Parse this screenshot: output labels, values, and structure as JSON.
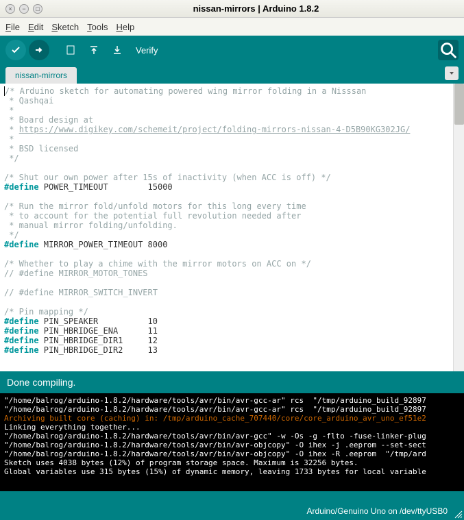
{
  "window": {
    "title": "nissan-mirrors | Arduino 1.8.2"
  },
  "menu": {
    "file": "File",
    "edit": "Edit",
    "sketch": "Sketch",
    "tools": "Tools",
    "help": "Help"
  },
  "toolbar": {
    "verify_label": "Verify"
  },
  "tab": {
    "name": "nissan-mirrors"
  },
  "code": {
    "c1": "/* Arduino sketch for automating powered wing mirror folding in a Nisssan",
    "c2": " * Qashqai",
    "c3": " *",
    "c4": " * Board design at",
    "c5a": " * ",
    "c5link": "https://www.digikey.com/schemeit/project/folding-mirrors-nissan-4-D5B90KG302JG/",
    "c6": " *",
    "c7": " * BSD licensed",
    "c8": " */",
    "c9": "/* Shut our own power after 15s of inactivity (when ACC is off) */",
    "d1": "#define",
    "d1n": " POWER_TIMEOUT        15000",
    "c10": "/* Run the mirror fold/unfold motors for this long every time",
    "c11": " * to account for the potential full revolution needed after",
    "c12": " * manual mirror folding/unfolding.",
    "c13": " */",
    "d2n": " MIRROR_POWER_TIMEOUT 8000",
    "c14": "/* Whether to play a chime with the mirror motors on ACC on */",
    "c15": "// #define MIRROR_MOTOR_TONES",
    "c16": "// #define MIRROR_SWITCH_INVERT",
    "c17": "/* Pin mapping */",
    "d3n": " PIN_SPEAKER          10",
    "d4n": " PIN_HBRIDGE_ENA      11",
    "d5n": " PIN_HBRIDGE_DIR1     12",
    "d6n": " PIN_HBRIDGE_DIR2     13"
  },
  "status": {
    "text": "Done compiling."
  },
  "console": {
    "l1": "\"/home/balrog/arduino-1.8.2/hardware/tools/avr/bin/avr-gcc-ar\" rcs  \"/tmp/arduino_build_92897",
    "l2": "\"/home/balrog/arduino-1.8.2/hardware/tools/avr/bin/avr-gcc-ar\" rcs  \"/tmp/arduino_build_92897",
    "l3": "Archiving built core (caching) in: /tmp/arduino_cache_707440/core/core_arduino_avr_uno_ef51e2",
    "l4": "Linking everything together...",
    "l5": "\"/home/balrog/arduino-1.8.2/hardware/tools/avr/bin/avr-gcc\" -w -Os -g -flto -fuse-linker-plug",
    "l6": "\"/home/balrog/arduino-1.8.2/hardware/tools/avr/bin/avr-objcopy\" -O ihex -j .eeprom --set-sect",
    "l7": "\"/home/balrog/arduino-1.8.2/hardware/tools/avr/bin/avr-objcopy\" -O ihex -R .eeprom  \"/tmp/ard",
    "l8": "Sketch uses 4038 bytes (12%) of program storage space. Maximum is 32256 bytes.",
    "l9": "Global variables use 315 bytes (15%) of dynamic memory, leaving 1733 bytes for local variable"
  },
  "footer": {
    "board": "Arduino/Genuino Uno on /dev/ttyUSB0"
  }
}
